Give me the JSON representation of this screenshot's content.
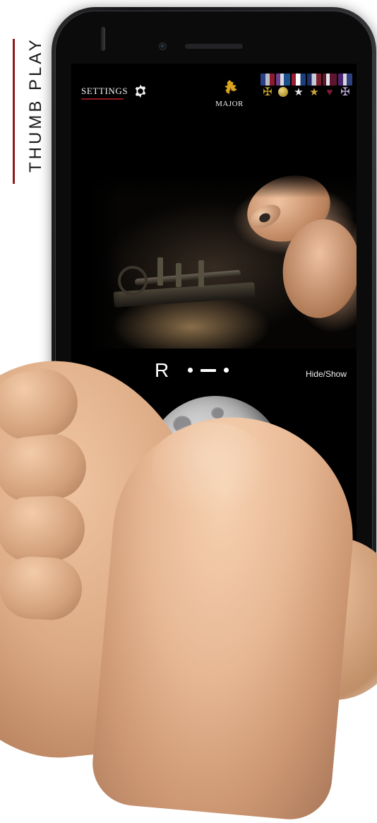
{
  "poster": {
    "side_label": "THUMB PLAY",
    "accent_color": "#8d1b1b"
  },
  "app": {
    "topbar": {
      "settings_label": "Settings",
      "settings_icon": "gear-icon",
      "rank": {
        "label": "Major",
        "insignia": "gold-oak-leaf-icon",
        "color": "#d9a41f"
      },
      "medals": [
        {
          "name": "medal-ribbon-1",
          "ribbon_colors": [
            "#2b3f86",
            "#b8bcc4",
            "#8d1b2d"
          ],
          "pendant": "cross-glyph",
          "pendant_color": "#c9a227"
        },
        {
          "name": "medal-ribbon-2",
          "ribbon_colors": [
            "#6b3f8f",
            "#d8d9dd",
            "#1d4f8c"
          ],
          "pendant": "disc",
          "pendant_color": "#d8b44a"
        },
        {
          "name": "medal-ribbon-3",
          "ribbon_colors": [
            "#9b1c2e",
            "#ffffff",
            "#1b3f7a"
          ],
          "pendant": "star-glyph",
          "pendant_color": "#e8e8ea"
        },
        {
          "name": "medal-ribbon-4",
          "ribbon_colors": [
            "#1f2f6d",
            "#c7ccd4",
            "#7a1b2b"
          ],
          "pendant": "star-glyph",
          "pendant_color": "#cfa63a"
        },
        {
          "name": "medal-ribbon-5",
          "ribbon_colors": [
            "#5e1530",
            "#e3e4e8",
            "#5e1530"
          ],
          "pendant": "heart-glyph",
          "pendant_color": "#6f1530"
        },
        {
          "name": "medal-ribbon-6",
          "ribbon_colors": [
            "#4b2470",
            "#d5d7dd",
            "#2d3f80"
          ],
          "pendant": "cross-glyph",
          "pendant_color": "#b9a4d8"
        }
      ]
    },
    "video": {
      "name": "telegraph-key-video",
      "description": "hands operating a telegraph key"
    },
    "morse": {
      "letter": "R",
      "code_symbols": [
        "dot",
        "dash",
        "dot"
      ],
      "code_text": "· — ·"
    },
    "hide_show_button": "Hide/Show",
    "moon": {
      "name": "moon-image"
    }
  }
}
